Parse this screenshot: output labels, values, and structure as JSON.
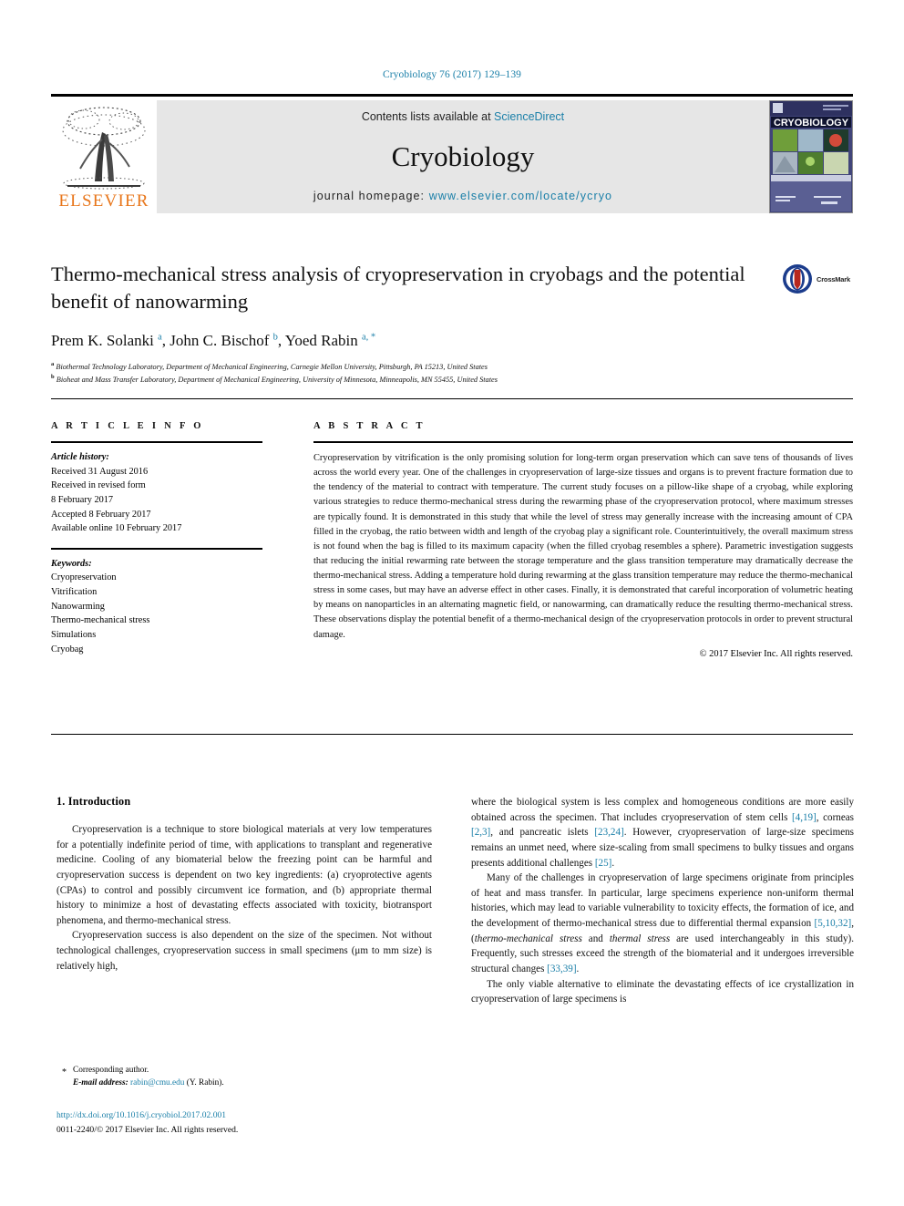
{
  "running_head": "Cryobiology 76 (2017) 129–139",
  "banner": {
    "publisher_name": "ELSEVIER",
    "tree_icon": "elsevier-tree-logo",
    "contents_prefix": "Contents lists available at ",
    "contents_link": "ScienceDirect",
    "journal_title": "Cryobiology",
    "homepage_prefix": "journal homepage: ",
    "homepage_url": "www.elsevier.com/locate/ycryo",
    "cover_caption": "CRYOBIOLOGY"
  },
  "article": {
    "title": "Thermo-mechanical stress analysis of cryopreservation in cryobags and the potential benefit of nanowarming",
    "authors_html": "Prem K. Solanki <sup>a</sup>, John C. Bischof <sup>b</sup>, Yoed Rabin <sup>a, *</sup>",
    "affiliations": [
      "Biothermal Technology Laboratory, Department of Mechanical Engineering, Carnegie Mellon University, Pittsburgh, PA 15213, United States",
      "Bioheat and Mass Transfer Laboratory, Department of Mechanical Engineering, University of Minnesota, Minneapolis, MN 55455, United States"
    ],
    "crossmark_label": "CrossMark"
  },
  "article_info": {
    "heading": "A R T I C L E   I N F O",
    "history_label": "Article history:",
    "history": [
      "Received 31 August 2016",
      "Received in revised form",
      "8 February 2017",
      "Accepted 8 February 2017",
      "Available online 10 February 2017"
    ],
    "keywords_label": "Keywords:",
    "keywords": [
      "Cryopreservation",
      "Vitrification",
      "Nanowarming",
      "Thermo-mechanical stress",
      "Simulations",
      "Cryobag"
    ]
  },
  "abstract": {
    "heading": "A B S T R A C T",
    "text": "Cryopreservation by vitrification is the only promising solution for long-term organ preservation which can save tens of thousands of lives across the world every year. One of the challenges in cryopreservation of large-size tissues and organs is to prevent fracture formation due to the tendency of the material to contract with temperature. The current study focuses on a pillow-like shape of a cryobag, while exploring various strategies to reduce thermo-mechanical stress during the rewarming phase of the cryopreservation protocol, where maximum stresses are typically found. It is demonstrated in this study that while the level of stress may generally increase with the increasing amount of CPA filled in the cryobag, the ratio between width and length of the cryobag play a significant role. Counterintuitively, the overall maximum stress is not found when the bag is filled to its maximum capacity (when the filled cryobag resembles a sphere). Parametric investigation suggests that reducing the initial rewarming rate between the storage temperature and the glass transition temperature may dramatically decrease the thermo-mechanical stress. Adding a temperature hold during rewarming at the glass transition temperature may reduce the thermo-mechanical stress in some cases, but may have an adverse effect in other cases. Finally, it is demonstrated that careful incorporation of volumetric heating by means on nanoparticles in an alternating magnetic field, or nanowarming, can dramatically reduce the resulting thermo-mechanical stress. These observations display the potential benefit of a thermo-mechanical design of the cryopreservation protocols in order to prevent structural damage.",
    "copyright": "© 2017 Elsevier Inc. All rights reserved."
  },
  "introduction": {
    "heading": "1. Introduction",
    "left_paragraphs": [
      "Cryopreservation is a technique to store biological materials at very low temperatures for a potentially indefinite period of time, with applications to transplant and regenerative medicine. Cooling of any biomaterial below the freezing point can be harmful and cryopreservation success is dependent on two key ingredients: (a) cryoprotective agents (CPAs) to control and possibly circumvent ice formation, and (b) appropriate thermal history to minimize a host of devastating effects associated with toxicity, biotransport phenomena, and thermo-mechanical stress.",
      "Cryopreservation success is also dependent on the size of the specimen. Not without technological challenges, cryopreservation success in small specimens (μm to mm size) is relatively high,"
    ],
    "right_paragraph_1_html": "where the biological system is less complex and homogeneous conditions are more easily obtained across the specimen. That includes cryopreservation of stem cells <span class=\"cite\">[4,19]</span>, corneas <span class=\"cite\">[2,3]</span>, and pancreatic islets <span class=\"cite\">[23,24]</span>. However, cryopreservation of large-size specimens remains an unmet need, where size-scaling from small specimens to bulky tissues and organs presents additional challenges <span class=\"cite\">[25]</span>.",
    "right_paragraph_2_html": "Many of the challenges in cryopreservation of large specimens originate from principles of heat and mass transfer. In particular, large specimens experience non-uniform thermal histories, which may lead to variable vulnerability to toxicity effects, the formation of ice, and the development of thermo-mechanical stress due to differential thermal expansion <span class=\"cite\">[5,10,32]</span>, (<span class=\"ital\">thermo-mechanical stress</span> and <span class=\"ital\">thermal stress</span> are used interchangeably in this study). Frequently, such stresses exceed the strength of the biomaterial and it undergoes irreversible structural changes <span class=\"cite\">[33,39]</span>.",
    "right_paragraph_3_html": "The only viable alternative to eliminate the devastating effects of ice crystallization in cryopreservation of large specimens is"
  },
  "footnote": {
    "star": "*",
    "corresponding": "Corresponding author.",
    "email_label": "E-mail address:",
    "email": "rabin@cmu.edu",
    "email_owner": "(Y. Rabin)."
  },
  "footer": {
    "doi": "http://dx.doi.org/10.1016/j.cryobiol.2017.02.001",
    "issn_line": "0011-2240/© 2017 Elsevier Inc. All rights reserved."
  },
  "colors": {
    "link": "#1a7fa8",
    "elsevier_orange": "#E8761B",
    "banner_gray": "#e6e6e6"
  }
}
